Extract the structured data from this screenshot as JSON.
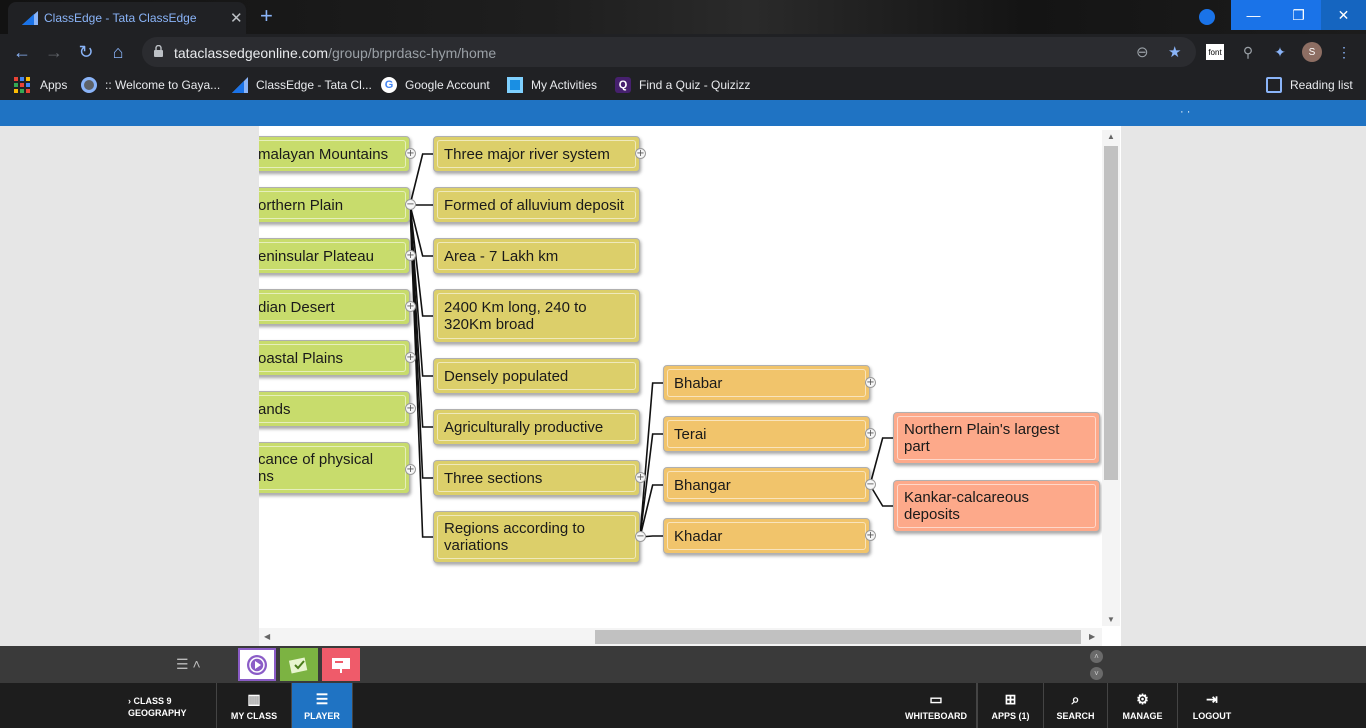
{
  "browser": {
    "tab_title": "ClassEdge - Tata ClassEdge",
    "url_host": "tataclassedgeonline.com",
    "url_path": "/group/brprdasc-hym/home",
    "profile_initial": "S",
    "font_ext_label": "font",
    "bookmarks": [
      {
        "label": "Apps",
        "icon": "apps-grid-icon"
      },
      {
        "label": ":: Welcome to Gaya...",
        "icon": "globe-icon"
      },
      {
        "label": "ClassEdge - Tata Cl...",
        "icon": "classedge-icon"
      },
      {
        "label": "Google Account",
        "icon": "google-icon"
      },
      {
        "label": "My Activities",
        "icon": "activities-icon"
      },
      {
        "label": "Find a Quiz - Quizizz",
        "icon": "quizizz-icon"
      }
    ],
    "reading_list": "Reading list"
  },
  "mindmap": {
    "level1": [
      {
        "label": "malayan Mountains"
      },
      {
        "label": "orthern Plain"
      },
      {
        "label": "eninsular Plateau"
      },
      {
        "label": "dian Desert"
      },
      {
        "label": "oastal Plains"
      },
      {
        "label": "ands"
      },
      {
        "label": "cance of physical\nns"
      }
    ],
    "level2": [
      {
        "label": "Three major river system"
      },
      {
        "label": "Formed of alluvium deposit"
      },
      {
        "label": "Area - 7 Lakh km"
      },
      {
        "label": "2400 Km long, 240 to\n320Km broad"
      },
      {
        "label": "Densely populated"
      },
      {
        "label": "Agriculturally productive"
      },
      {
        "label": "Three sections"
      },
      {
        "label": "Regions according to\nvariations"
      }
    ],
    "level3": [
      {
        "label": "Bhabar"
      },
      {
        "label": "Terai"
      },
      {
        "label": "Bhangar"
      },
      {
        "label": "Khadar"
      }
    ],
    "level4": [
      {
        "label": "Northern Plain's largest\npart"
      },
      {
        "label": "Kankar-calcareous\ndeposits"
      }
    ],
    "colors": {
      "level1": "#c8dc6c",
      "level2": "#dccf6a",
      "level3": "#f1c46b",
      "level4": "#fda98a"
    }
  },
  "app_nav": {
    "class_line1": "CLASS 9",
    "class_line2": "GEOGRAPHY",
    "my_class": "MY CLASS",
    "player": "PLAYER",
    "whiteboard": "WHITEBOARD",
    "apps": "APPS (1)",
    "search": "SEARCH",
    "manage": "MANAGE",
    "logout": "LOGOUT"
  }
}
